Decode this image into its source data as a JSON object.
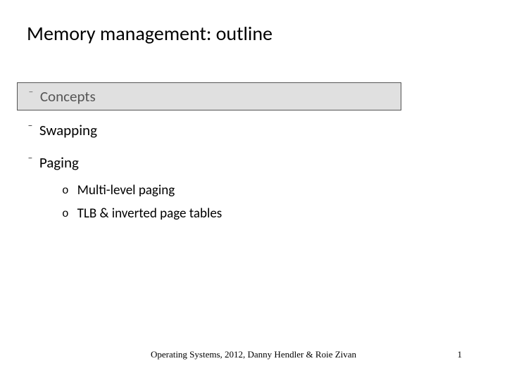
{
  "title": "Memory management: outline",
  "items": [
    {
      "label": "Concepts",
      "highlighted": true
    },
    {
      "label": "Swapping",
      "highlighted": false
    },
    {
      "label": "Paging",
      "highlighted": false
    }
  ],
  "subitems": [
    {
      "label": "Multi-level paging"
    },
    {
      "label": "TLB & inverted page tables"
    }
  ],
  "footer": "Operating Systems, 2012, Danny Hendler & Roie Zivan",
  "page_number": "1",
  "bullet_glyph": "−",
  "sub_bullet_glyph": "o"
}
